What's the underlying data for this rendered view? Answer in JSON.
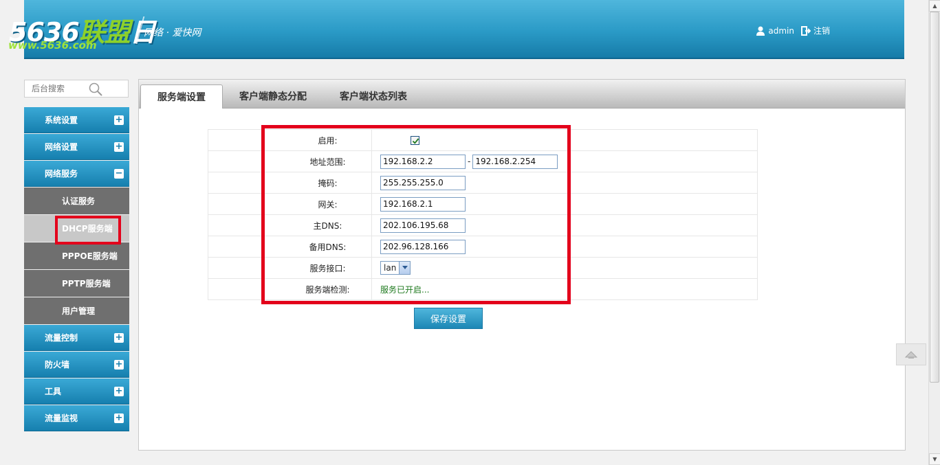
{
  "brand": {
    "logo_main_a": "5636",
    "logo_main_b": "联盟",
    "logo_tail": "日",
    "logo_url": "www.5636.com",
    "slogan": "网络 · 爱快网",
    "colors": {
      "header": "#2a9ac6",
      "accent_green": "#8dd12a"
    }
  },
  "user": {
    "name": "admin",
    "logout": "注销",
    "icons": [
      "user-icon",
      "logout-icon"
    ]
  },
  "search": {
    "placeholder": "后台搜索",
    "icon": "search-icon"
  },
  "sidebar": {
    "groups": [
      {
        "label": "系统设置",
        "toggle": "+"
      },
      {
        "label": "网络设置",
        "toggle": "+"
      },
      {
        "label": "网络服务",
        "toggle": "−"
      }
    ],
    "sub_items": [
      {
        "label": "认证服务"
      },
      {
        "label": "DHCP服务端"
      },
      {
        "label": "PPPOE服务端"
      },
      {
        "label": "PPTP服务端"
      },
      {
        "label": "用户管理"
      }
    ],
    "groups_after": [
      {
        "label": "流量控制",
        "toggle": "+"
      },
      {
        "label": "防火墙",
        "toggle": "+"
      },
      {
        "label": "工具",
        "toggle": "+"
      },
      {
        "label": "流量监视",
        "toggle": "+"
      }
    ]
  },
  "tabs": [
    {
      "label": "服务端设置",
      "active": true
    },
    {
      "label": "客户端静态分配",
      "active": false
    },
    {
      "label": "客户端状态列表",
      "active": false
    }
  ],
  "form": {
    "enable_label": "启用:",
    "enable_checked": true,
    "range_label": "地址范围:",
    "range_start": "192.168.2.2",
    "range_sep": "-",
    "range_end": "192.168.2.254",
    "mask_label": "掩码:",
    "mask": "255.255.255.0",
    "gateway_label": "网关:",
    "gateway": "192.168.2.1",
    "dns1_label": "主DNS:",
    "dns1": "202.106.195.68",
    "dns2_label": "备用DNS:",
    "dns2": "202.96.128.166",
    "iface_label": "服务接口:",
    "iface": "lan",
    "check_label": "服务端检测:",
    "check_status": "服务已开启..."
  },
  "save_label": "保存设置"
}
